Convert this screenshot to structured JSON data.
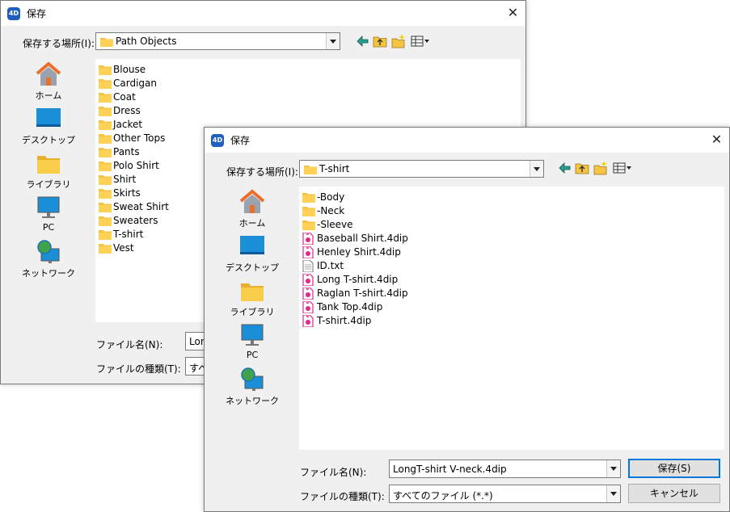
{
  "colors": {
    "accent": "#0078d7",
    "folder": "#f6c342",
    "doc_pink": "#e0288a"
  },
  "back_dialog": {
    "title": "保存",
    "app_icon": "4D",
    "location_label": "保存する場所(I):",
    "location_value": "Path Objects",
    "places": [
      "ホーム",
      "デスクトップ",
      "ライブラリ",
      "PC",
      "ネットワーク"
    ],
    "files": [
      "Blouse",
      "Cardigan",
      "Coat",
      "Dress",
      "Jacket",
      "Other Tops",
      "Pants",
      "Polo Shirt",
      "Shirt",
      "Skirts",
      "Sweat Shirt",
      "Sweaters",
      "T-shirt",
      "Vest"
    ],
    "filename_label": "ファイル名(N):",
    "filename_value": "Lon",
    "filetype_label": "ファイルの種類(T):",
    "filetype_value": "すべ"
  },
  "front_dialog": {
    "title": "保存",
    "app_icon": "4D",
    "location_label": "保存する場所(I):",
    "location_value": "T-shirt",
    "places": [
      "ホーム",
      "デスクトップ",
      "ライブラリ",
      "PC",
      "ネットワーク"
    ],
    "files": [
      {
        "name": "-Body",
        "icon": "folder-icon"
      },
      {
        "name": "-Neck",
        "icon": "folder-icon"
      },
      {
        "name": "-Sleeve",
        "icon": "folder-icon"
      },
      {
        "name": "Baseball Shirt.4dip",
        "icon": "4dip-file-icon"
      },
      {
        "name": "Henley Shirt.4dip",
        "icon": "4dip-file-icon"
      },
      {
        "name": "ID.txt",
        "icon": "text-file-icon"
      },
      {
        "name": "Long T-shirt.4dip",
        "icon": "4dip-file-icon"
      },
      {
        "name": "Raglan T-shirt.4dip",
        "icon": "4dip-file-icon"
      },
      {
        "name": "Tank Top.4dip",
        "icon": "4dip-file-icon"
      },
      {
        "name": "T-shirt.4dip",
        "icon": "4dip-file-icon"
      }
    ],
    "filename_label": "ファイル名(N):",
    "filename_value": "LongT-shirt V-neck.4dip",
    "filetype_label": "ファイルの種類(T):",
    "filetype_value": "すべてのファイル (*.*)",
    "save_button": "保存(S)",
    "cancel_button": "キャンセル"
  },
  "toolbar_icons": [
    "back-arrow-icon",
    "up-folder-icon",
    "new-folder-icon",
    "view-menu-icon"
  ]
}
